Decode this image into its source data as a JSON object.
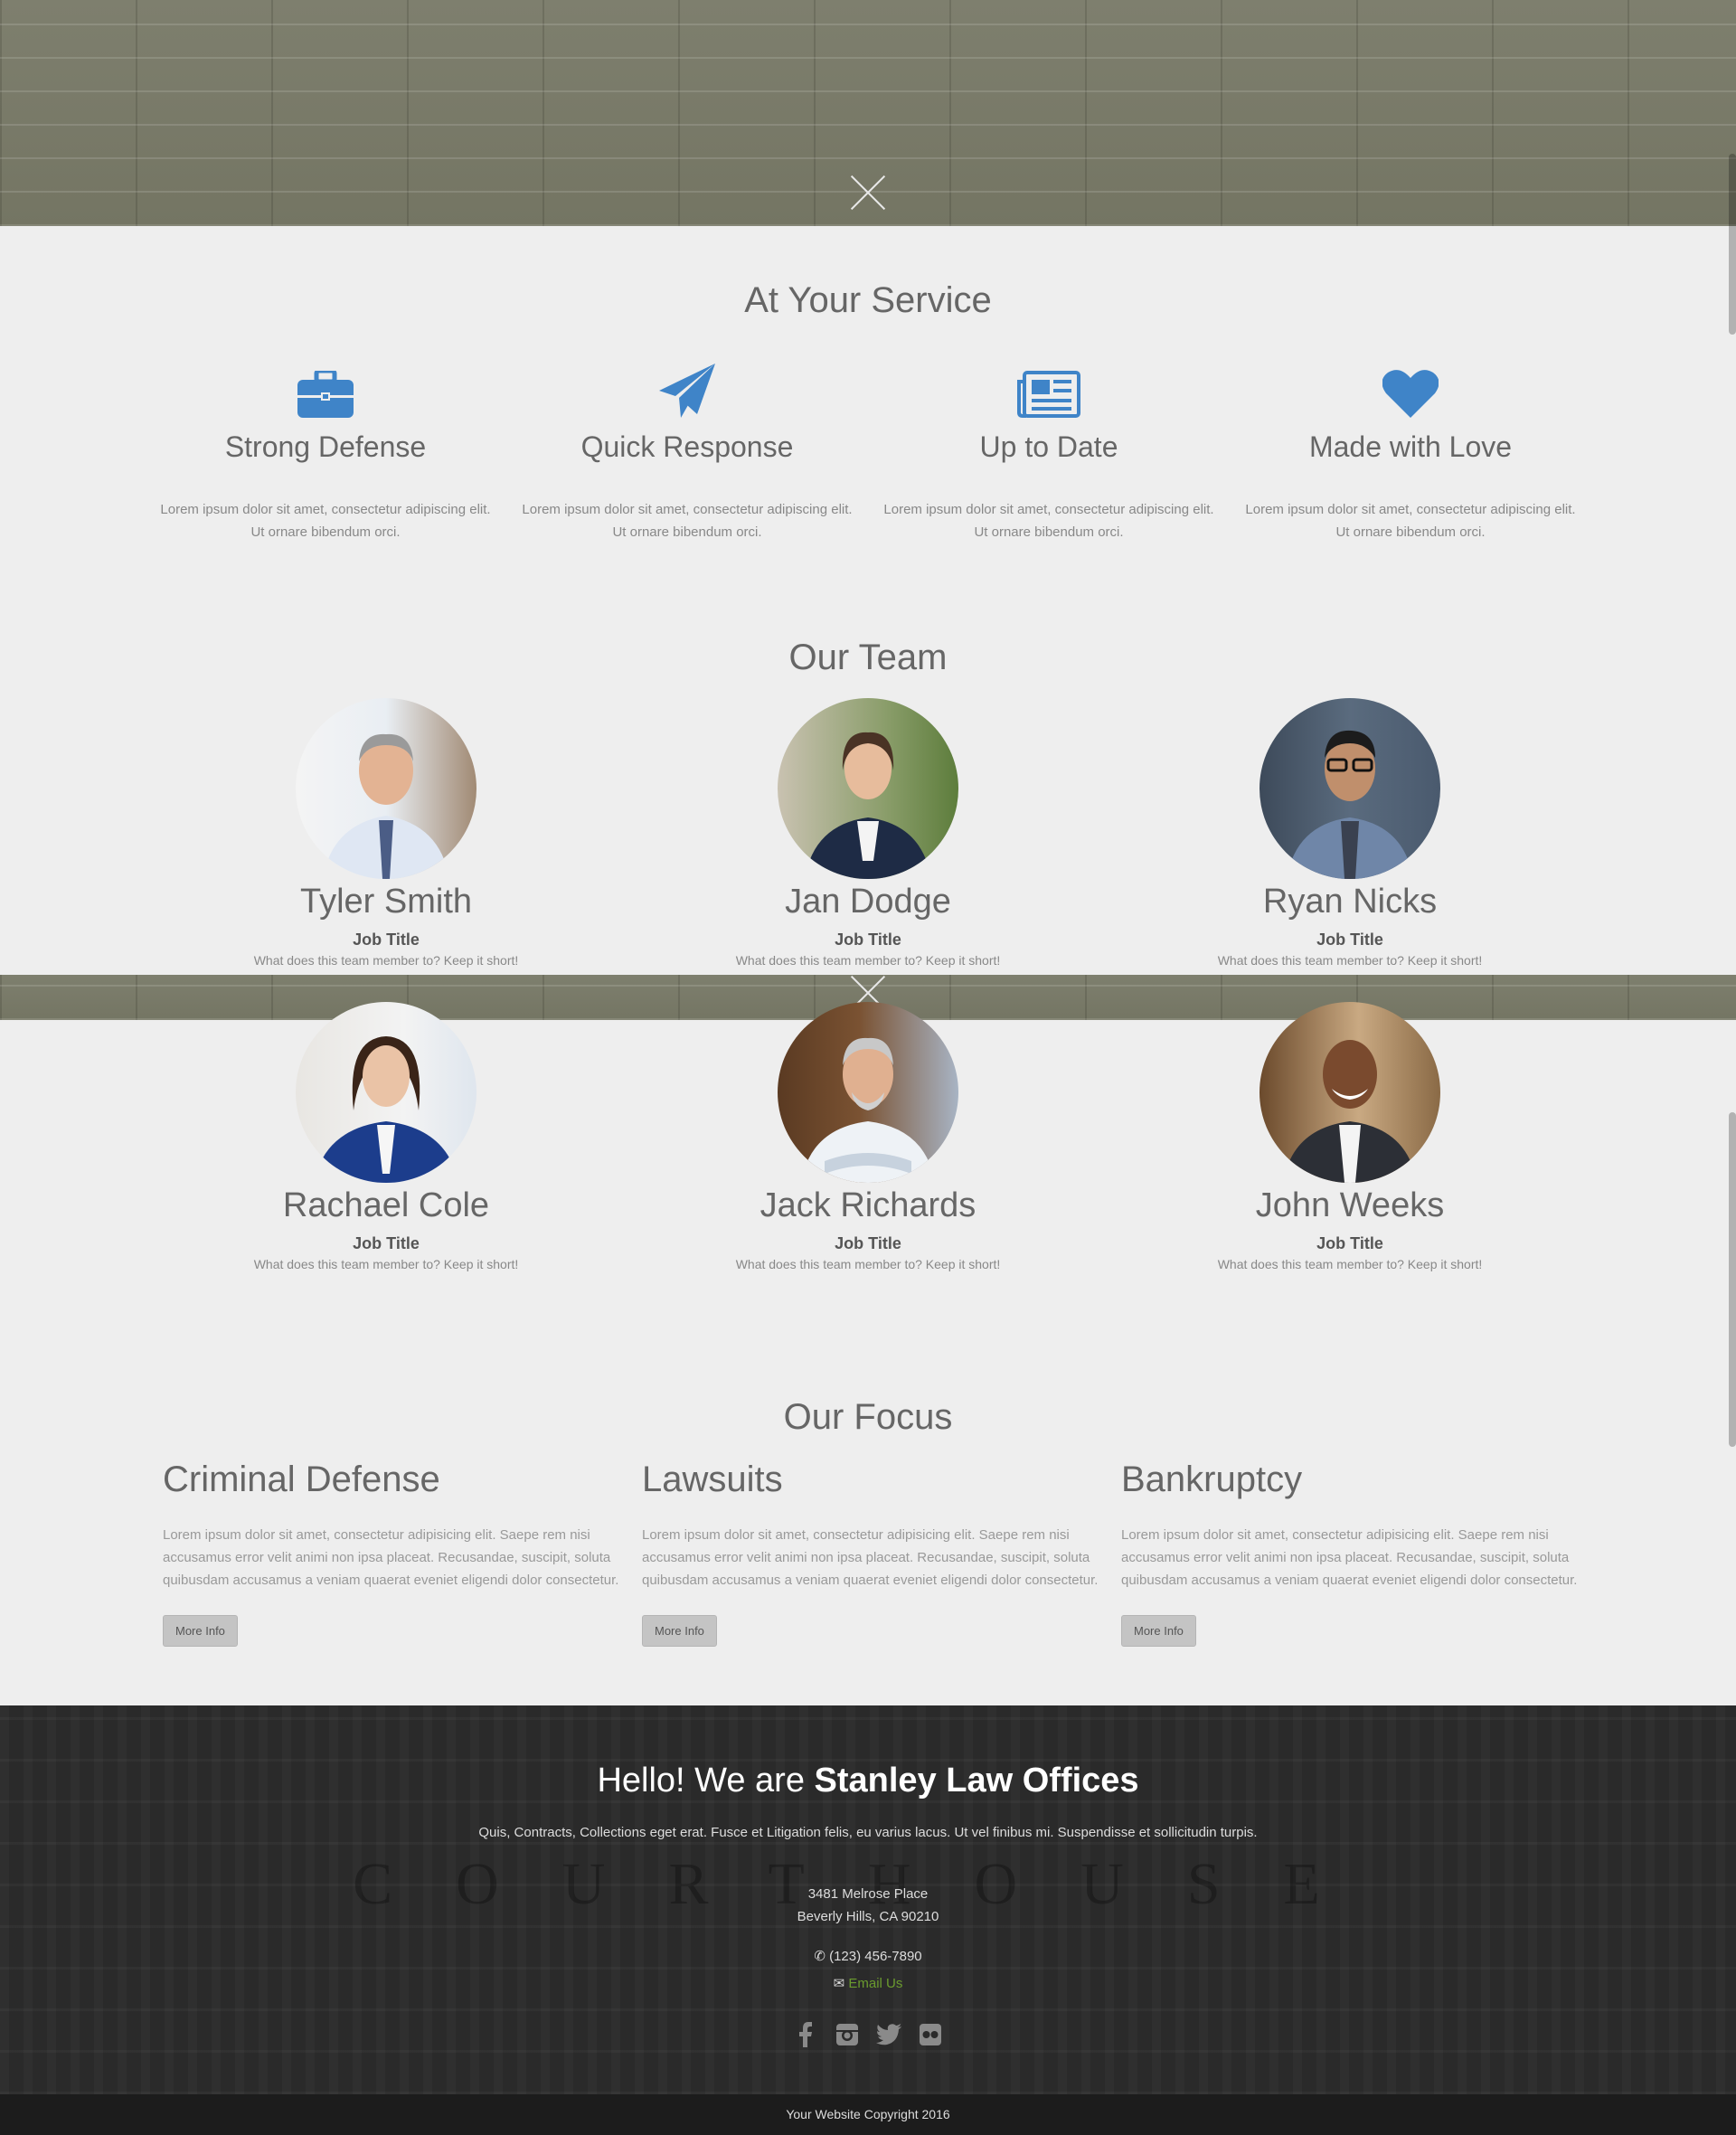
{
  "service": {
    "title": "At Your Service",
    "items": [
      {
        "icon": "briefcase-icon",
        "title": "Strong Defense",
        "text": "Lorem ipsum dolor sit amet, consectetur adipiscing elit. Ut ornare bibendum orci."
      },
      {
        "icon": "paper-plane-icon",
        "title": "Quick Response",
        "text": "Lorem ipsum dolor sit amet, consectetur adipiscing elit. Ut ornare bibendum orci."
      },
      {
        "icon": "newspaper-icon",
        "title": "Up to Date",
        "text": "Lorem ipsum dolor sit amet, consectetur adipiscing elit. Ut ornare bibendum orci."
      },
      {
        "icon": "heart-icon",
        "title": "Made with Love",
        "text": "Lorem ipsum dolor sit amet, consectetur adipiscing elit. Ut ornare bibendum orci."
      }
    ],
    "icon_color": "#3f84c8"
  },
  "team": {
    "title": "Our Team",
    "members": [
      {
        "name": "Tyler Smith",
        "job": "Job Title",
        "desc": "What does this team member to? Keep it short!"
      },
      {
        "name": "Jan Dodge",
        "job": "Job Title",
        "desc": "What does this team member to? Keep it short!"
      },
      {
        "name": "Ryan Nicks",
        "job": "Job Title",
        "desc": "What does this team member to? Keep it short!"
      },
      {
        "name": "Rachael Cole",
        "job": "Job Title",
        "desc": "What does this team member to? Keep it short!"
      },
      {
        "name": "Jack Richards",
        "job": "Job Title",
        "desc": "What does this team member to? Keep it short!"
      },
      {
        "name": "John Weeks",
        "job": "Job Title",
        "desc": "What does this team member to? Keep it short!"
      }
    ]
  },
  "focus": {
    "title": "Our Focus",
    "items": [
      {
        "title": "Criminal Defense",
        "text": "Lorem ipsum dolor sit amet, consectetur adipisicing elit. Saepe rem nisi accusamus error velit animi non ipsa placeat. Recusandae, suscipit, soluta quibusdam accusamus a veniam quaerat eveniet eligendi dolor consectetur.",
        "button": "More Info"
      },
      {
        "title": "Lawsuits",
        "text": "Lorem ipsum dolor sit amet, consectetur adipisicing elit. Saepe rem nisi accusamus error velit animi non ipsa placeat. Recusandae, suscipit, soluta quibusdam accusamus a veniam quaerat eveniet eligendi dolor consectetur.",
        "button": "More Info"
      },
      {
        "title": "Bankruptcy",
        "text": "Lorem ipsum dolor sit amet, consectetur adipisicing elit. Saepe rem nisi accusamus error velit animi non ipsa placeat. Recusandae, suscipit, soluta quibusdam accusamus a veniam quaerat eveniet eligendi dolor consectetur.",
        "button": "More Info"
      }
    ]
  },
  "footer": {
    "hello_prefix": "Hello! We are",
    "hello_name": "Stanley Law Offices",
    "tagline": "Quis, Contracts, Collections eget erat. Fusce et Litigation felis, eu varius lacus. Ut vel finibus mi. Suspendisse et sollicitudin turpis.",
    "address_line1": "3481 Melrose Place",
    "address_line2": "Beverly Hills, CA 90210",
    "phone": "(123) 456-7890",
    "email_label": "Email Us",
    "background_text": "COURTHOUSE",
    "socials": [
      "facebook-icon",
      "instagram-icon",
      "twitter-icon",
      "flickr-icon"
    ],
    "link_color": "#6a9b2e"
  },
  "copyright": "Your Website Copyright 2016"
}
